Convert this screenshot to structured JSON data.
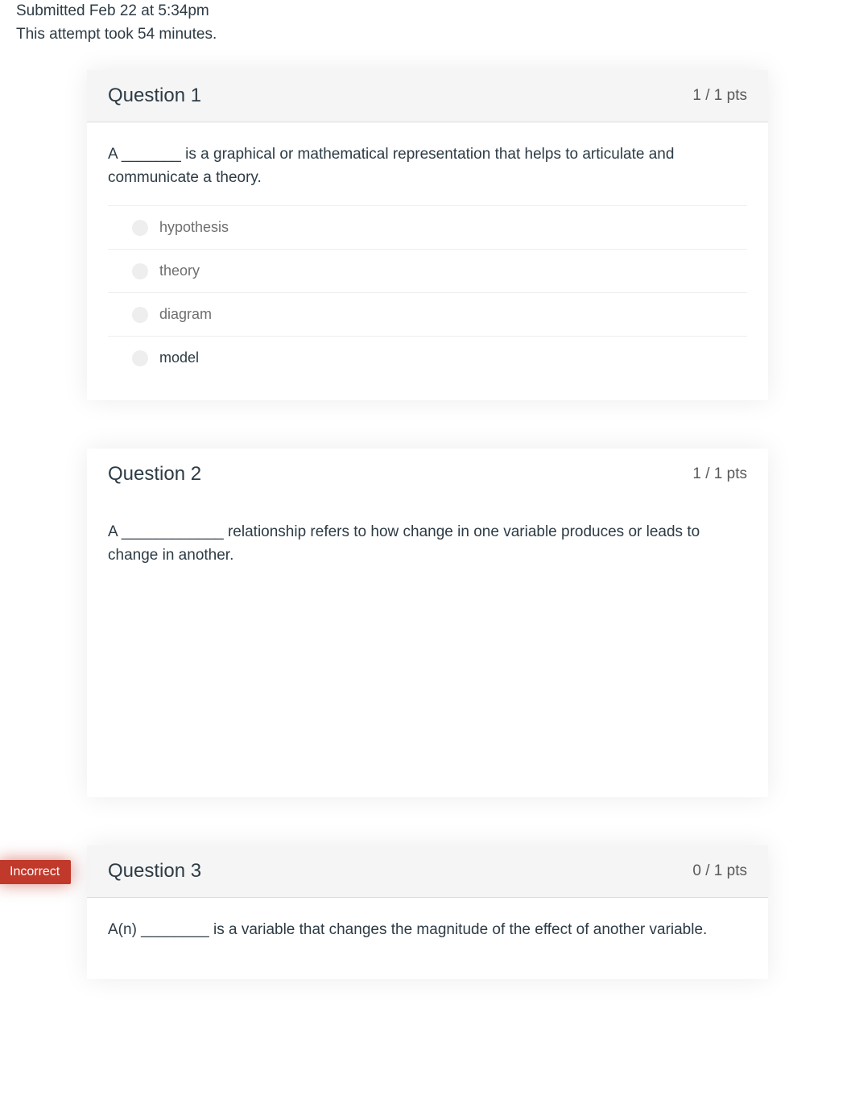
{
  "meta": {
    "submitted": "Submitted Feb 22 at 5:34pm",
    "duration": "This attempt took 54 minutes."
  },
  "flags": {
    "incorrect": "Incorrect"
  },
  "questions": [
    {
      "title": "Question 1",
      "points": "1 / 1 pts",
      "prompt": "A _______ is a graphical or mathematical representation that helps to articulate and communicate a theory.",
      "answers": [
        {
          "text": "hypothesis",
          "correct": false
        },
        {
          "text": "theory",
          "correct": false
        },
        {
          "text": "diagram",
          "correct": false
        },
        {
          "text": "model",
          "correct": true
        }
      ]
    },
    {
      "title": "Question 2",
      "points": "1 / 1 pts",
      "prompt": "A ____________ relationship refers to how change in one variable produces or leads to change in another."
    },
    {
      "title": "Question 3",
      "points": "0 / 1 pts",
      "prompt": "A(n) ________ is a variable that changes the magnitude of the effect of another variable.",
      "incorrect": true
    }
  ]
}
